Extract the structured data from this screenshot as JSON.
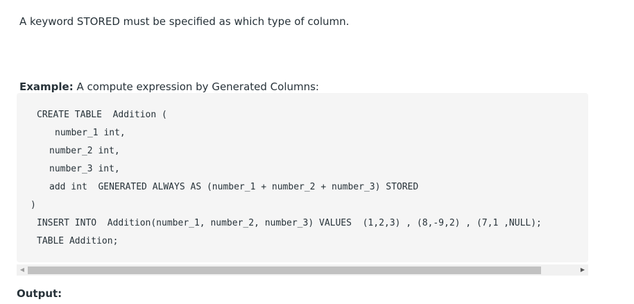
{
  "intro_text": "A keyword STORED must be specified as which type of column.",
  "example": {
    "label": "Example:",
    "text": " A compute expression by Generated Columns:"
  },
  "code_lines": [
    "CREATE TABLE  Addition (",
    "number_1 int,",
    "number_2 int,",
    "number_3 int,",
    "add int  GENERATED ALWAYS AS (number_1 + number_2 + number_3) STORED",
    ")",
    "INSERT INTO  Addition(number_1, number_2, number_3) VALUES  (1,2,3) , (8,-9,2) , (7,1 ,NULL);",
    "TABLE Addition;"
  ],
  "scrollbar": {
    "left_arrow": "◀",
    "right_arrow": "▶"
  },
  "output_label": "Output:"
}
